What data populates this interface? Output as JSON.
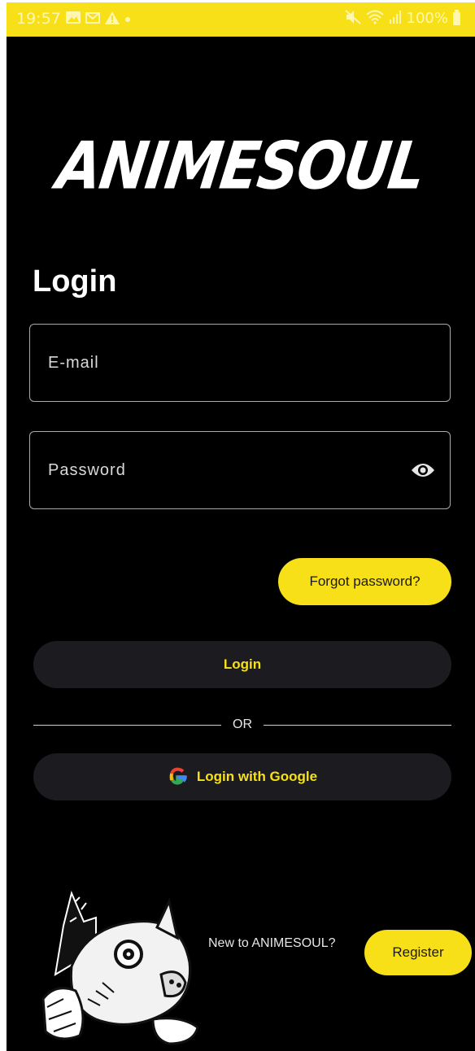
{
  "status_bar": {
    "time": "19:57",
    "left_icons": [
      "gallery-icon",
      "mail-icon",
      "warning-icon",
      "dot-icon"
    ],
    "right_icons": [
      "mute-icon",
      "wifi-icon",
      "signal-icon"
    ],
    "battery": "100%"
  },
  "app": {
    "logo": "ANIMESOUL",
    "title": "Login"
  },
  "form": {
    "email_placeholder": "E-mail",
    "email_value": "",
    "password_placeholder": "Password",
    "password_value": "",
    "password_toggle_icon": "eye-icon"
  },
  "actions": {
    "forgot_label": "Forgot password?",
    "login_label": "Login",
    "divider_label": "OR",
    "google_label": "Login with Google"
  },
  "footer": {
    "prompt": "New to ANIMESOUL?",
    "register_label": "Register"
  },
  "colors": {
    "accent": "#f7e017",
    "background": "#000000",
    "button_dark": "#1c1c20"
  }
}
